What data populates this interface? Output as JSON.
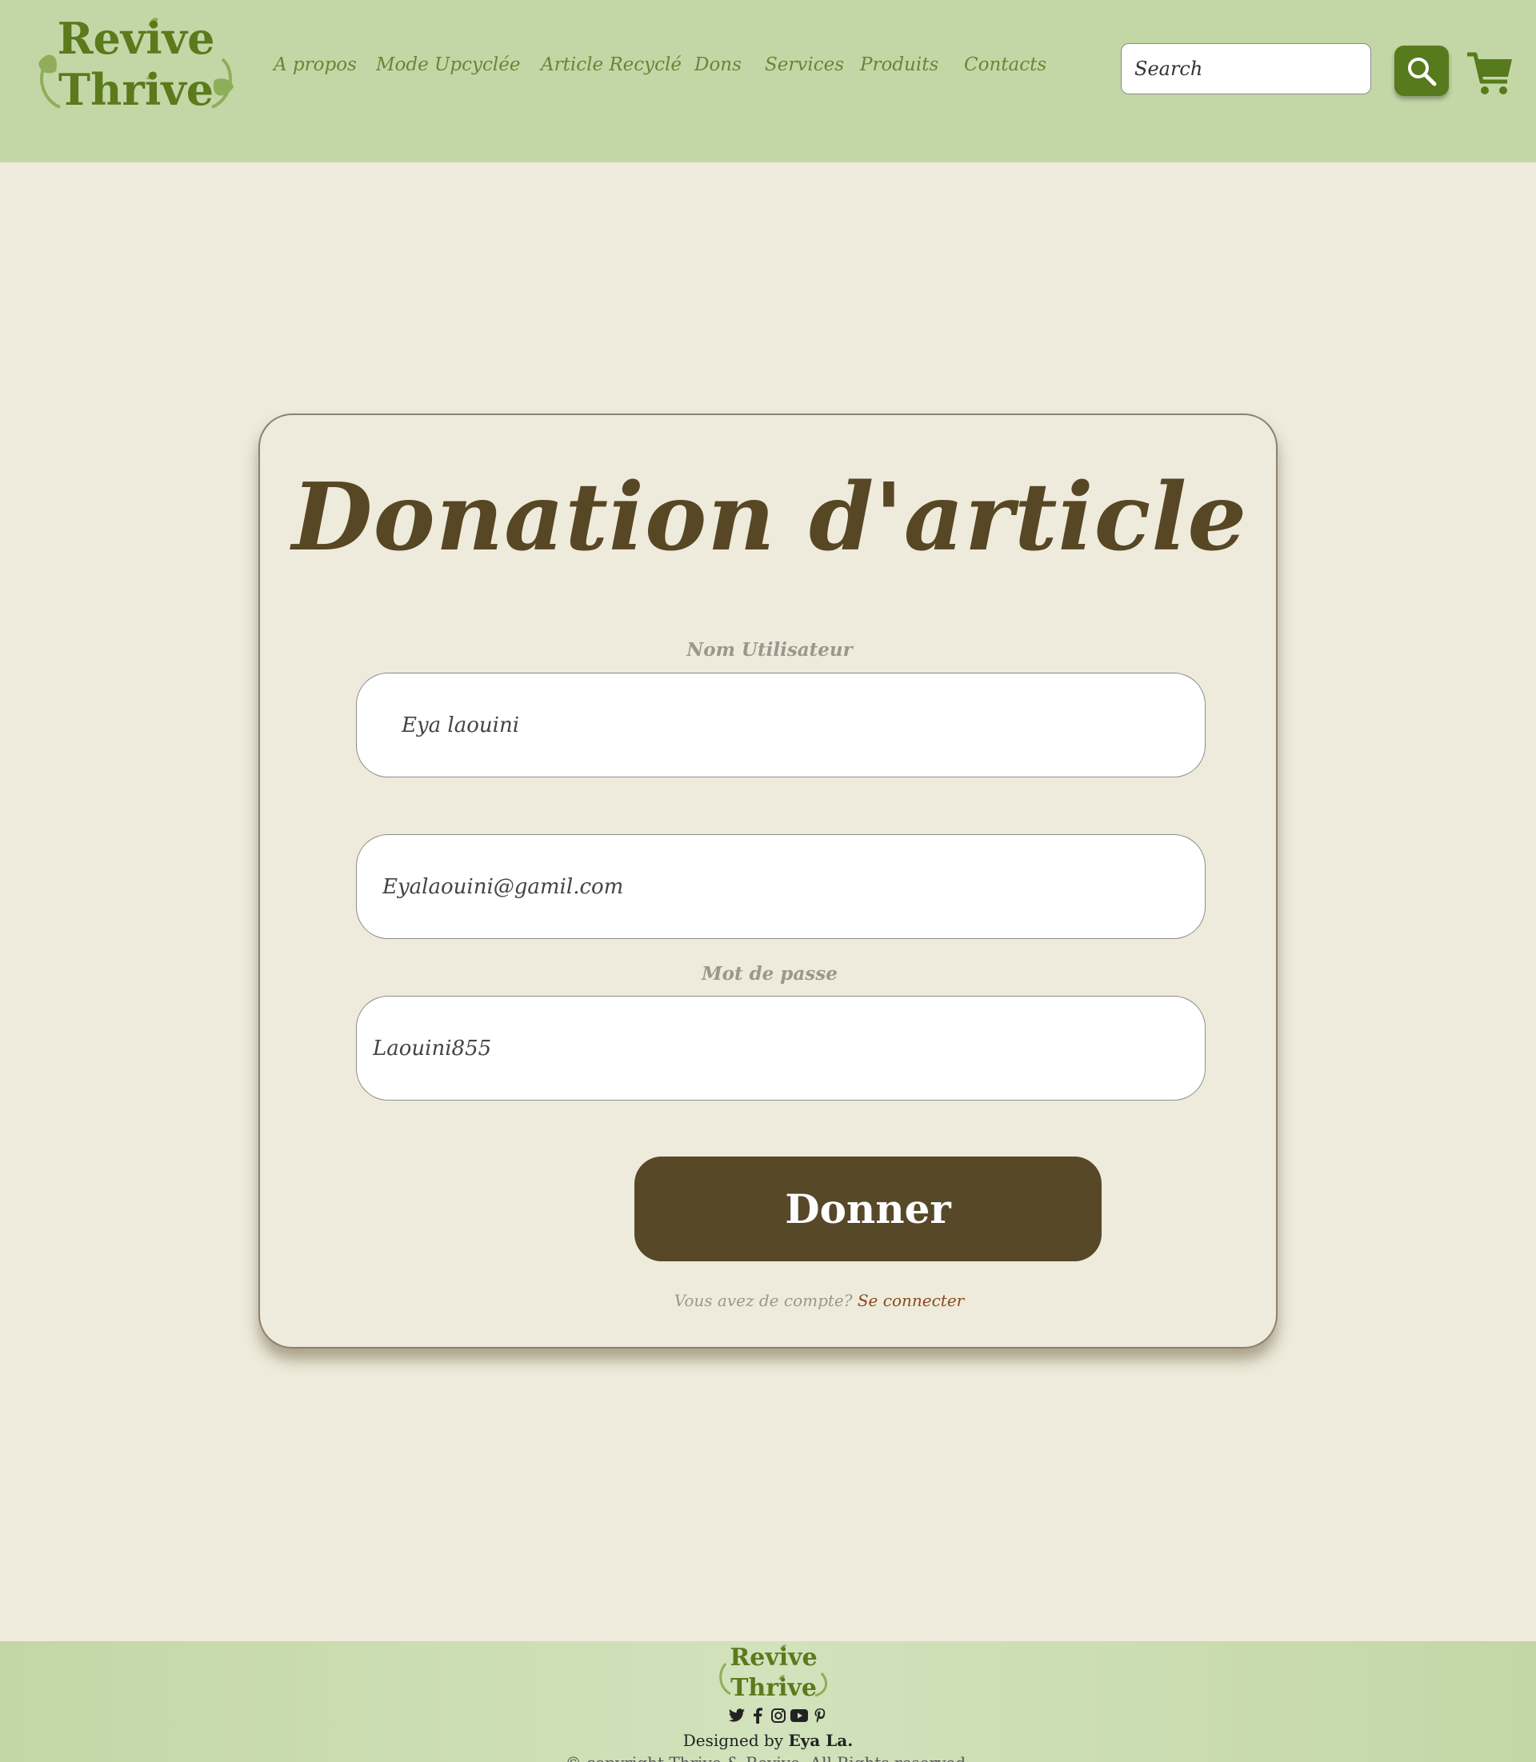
{
  "brand": {
    "line1": "Revive",
    "line2": "Thrive"
  },
  "nav": {
    "items": [
      "A propos",
      "Mode Upcyclée",
      "Article Recyclé",
      "Dons",
      "Services",
      "Produits",
      "Contacts"
    ]
  },
  "search": {
    "placeholder": "Search"
  },
  "form": {
    "title": "Donation d'article",
    "username_label": "Nom Utilisateur",
    "username_value": "Eya laouini",
    "email_value": "Eyalaouini@gamil.com",
    "password_label": "Mot de passe",
    "password_value": "Laouini855",
    "submit_label": "Donner",
    "account_text": "Vous avez  de compte?",
    "login_link": "Se connecter"
  },
  "footer": {
    "designed_prefix": "Designed by",
    "designer": "Eya La.",
    "copyright": "© copyright Thrive & Revive. All Rights reserved."
  },
  "colors": {
    "header_bg": "#c3d7a6",
    "page_bg": "#eeebdc",
    "brand_green": "#577a1c",
    "primary_brown": "#574828",
    "link_brown": "#8b4a1e"
  },
  "icons": [
    "search-icon",
    "cart-icon",
    "twitter-icon",
    "facebook-icon",
    "instagram-icon",
    "youtube-icon",
    "pinterest-icon"
  ]
}
